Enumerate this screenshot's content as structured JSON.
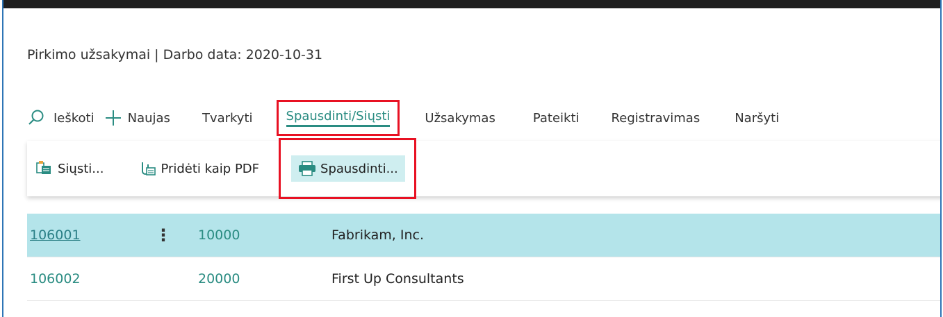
{
  "context_line": "Pirkimo užsakymai | Darbo data: 2020-10-31",
  "actions": [
    {
      "id": "search",
      "label": "Ieškoti",
      "icon": "search-icon"
    },
    {
      "id": "new",
      "label": "Naujas",
      "icon": "plus-icon"
    },
    {
      "id": "manage",
      "label": "Tvarkyti"
    },
    {
      "id": "print_send",
      "label": "Spausdinti/Siųsti",
      "active": true
    },
    {
      "id": "order",
      "label": "Užsakymas"
    },
    {
      "id": "submit",
      "label": "Pateikti"
    },
    {
      "id": "post",
      "label": "Registravimas"
    },
    {
      "id": "navigate",
      "label": "Naršyti"
    }
  ],
  "subactions": [
    {
      "id": "send",
      "label": "Siųsti...",
      "icon": "send-document-icon"
    },
    {
      "id": "attach_pdf",
      "label": "Pridėti kaip PDF",
      "icon": "attach-pdf-icon"
    },
    {
      "id": "print",
      "label": "Spausdinti...",
      "icon": "printer-icon"
    }
  ],
  "colors": {
    "accent": "#2a8c82",
    "highlight_box": "#e81123",
    "selected_row": "#b4e4ea",
    "frame_border": "#2e75b6"
  },
  "rows": [
    {
      "no": "106001",
      "vendor_no": "10000",
      "vendor_name": "Fabrikam, Inc.",
      "selected": true
    },
    {
      "no": "106002",
      "vendor_no": "20000",
      "vendor_name": "First Up Consultants",
      "selected": false
    }
  ]
}
